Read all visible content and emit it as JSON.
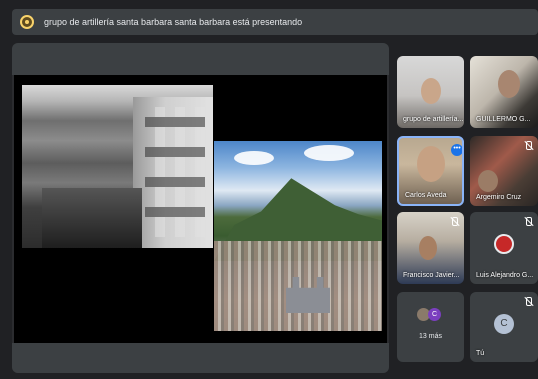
{
  "banner": {
    "text": "grupo de artillería santa barbara santa barbara está presentando"
  },
  "presentation": {
    "label": "presentation-slide"
  },
  "participants": [
    {
      "name": "grupo de artillería...",
      "muted": false
    },
    {
      "name": "GUILLERMO G...",
      "muted": false
    },
    {
      "name": "Carlos Aveda",
      "muted": false,
      "speaking": true,
      "more": "•••"
    },
    {
      "name": "Argemiro Cruz",
      "muted": true
    },
    {
      "name": "Francisco Javier...",
      "muted": true
    },
    {
      "name": "Luis Alejandro G...",
      "muted": true,
      "avatar_color": "#c62828"
    },
    {
      "more_count": "13 más",
      "avatar_letter": "C"
    },
    {
      "name": "Tú",
      "muted": true,
      "avatar_letter": "C"
    }
  ],
  "colors": {
    "background": "#202124",
    "tile": "#3c4043",
    "active_border": "#8ab4f8"
  }
}
